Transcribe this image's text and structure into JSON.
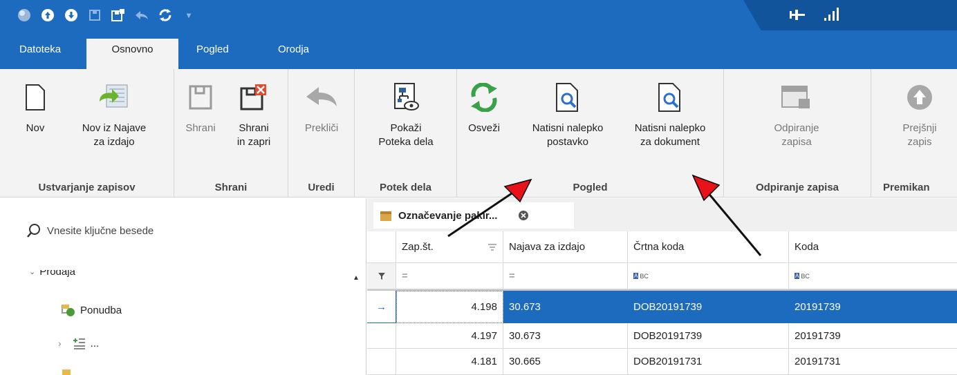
{
  "tabs": [
    "Datoteka",
    "Osnovno",
    "Pogled",
    "Orodja"
  ],
  "ribbon": {
    "groups": {
      "create": "Ustvarjanje zapisov",
      "save": "Shrani",
      "edit": "Uredi",
      "workflow": "Potek dela",
      "view": "Pogled",
      "open": "Odpiranje zapisa",
      "move": "Premikan"
    },
    "buttons": {
      "new": "Nov",
      "new_from_notice_1": "Nov iz Najave",
      "new_from_notice_2": "za izdajo",
      "save": "Shrani",
      "save_close_1": "Shrani",
      "save_close_2": "in zapri",
      "cancel": "Prekliči",
      "show_flow_1": "Pokaži",
      "show_flow_2": "Poteka dela",
      "refresh": "Osveži",
      "print_item_1": "Natisni nalepko",
      "print_item_2": "postavko",
      "print_doc_1": "Natisni nalepko",
      "print_doc_2": "za dokument",
      "unlock_1": "Odpiranje",
      "unlock_2": "zapisa",
      "prev_1": "Prejšnji",
      "prev_2": "zapis"
    }
  },
  "left_pane": {
    "search_placeholder": "Vnesite ključne besede",
    "group_label": "Prodaja",
    "items": [
      "Ponudba",
      "..."
    ]
  },
  "document_tab": {
    "title": "Označevanje pakir..."
  },
  "grid": {
    "columns": [
      "Zap.št.",
      "Najava za izdajo",
      "Črtna koda",
      "Koda"
    ],
    "filter_row": [
      "=",
      "=",
      "BC",
      "BC"
    ],
    "rows": [
      [
        "4.198",
        "30.673",
        "DOB20191739",
        "20191739"
      ],
      [
        "4.197",
        "30.673",
        "DOB20191739",
        "20191739"
      ],
      [
        "4.181",
        "30.665",
        "DOB20191731",
        "20191731"
      ]
    ]
  },
  "colors": {
    "accent": "#1c6bbf",
    "ribbon_bg": "#f3f3f3",
    "arrow_red": "#e8121b"
  }
}
